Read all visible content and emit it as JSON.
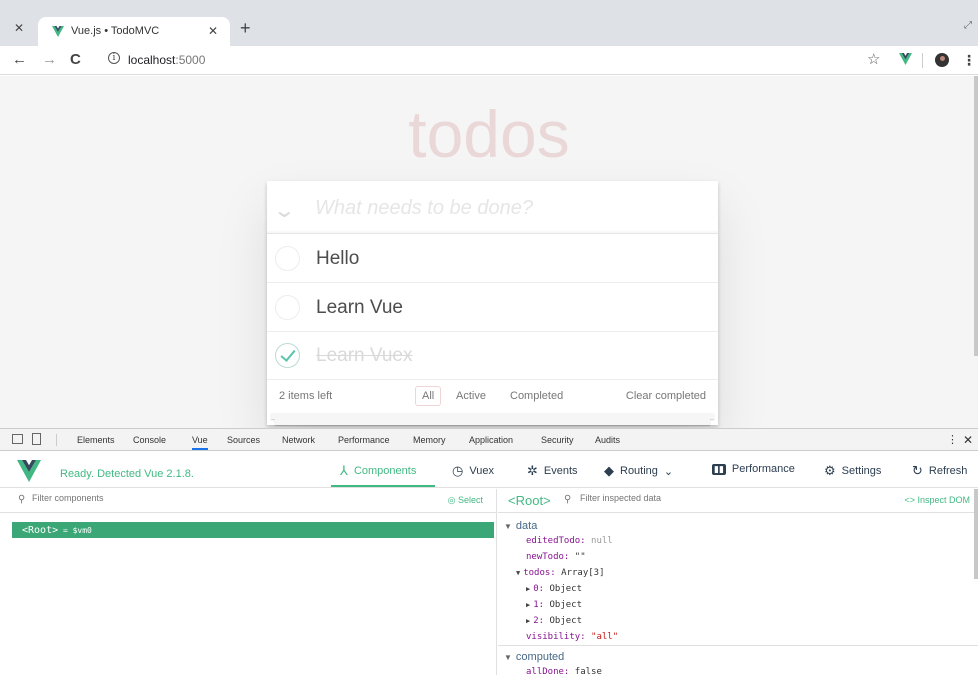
{
  "browser": {
    "tab_title": "Vue.js • TodoMVC",
    "url_host": "localhost",
    "url_port": ":5000"
  },
  "app": {
    "title": "todos",
    "new_todo_placeholder": "What needs to be done?",
    "todos": [
      {
        "label": "Hello",
        "completed": false
      },
      {
        "label": "Learn Vue",
        "completed": false
      },
      {
        "label": "Learn Vuex",
        "completed": true
      }
    ],
    "items_left": "2 items left",
    "filters": [
      "All",
      "Active",
      "Completed"
    ],
    "selected_filter": "All",
    "clear_completed": "Clear completed"
  },
  "devtools": {
    "tabs": [
      "Elements",
      "Console",
      "Vue",
      "Sources",
      "Network",
      "Performance",
      "Memory",
      "Application",
      "Security",
      "Audits"
    ],
    "active_tab": "Vue",
    "vue": {
      "status": "Ready. Detected Vue 2.1.8.",
      "toolbar": {
        "components": "Components",
        "vuex": "Vuex",
        "events": "Events",
        "routing": "Routing",
        "performance": "Performance",
        "settings": "Settings",
        "refresh": "Refresh"
      },
      "filter_components_placeholder": "Filter components",
      "select_label": "Select",
      "root_component": "<Root>",
      "root_ref": "= $vm0",
      "inspected_tag": "<Root>",
      "filter_inspected_placeholder": "Filter inspected data",
      "inspect_dom": "<> Inspect DOM",
      "data_section": "data",
      "data": {
        "editedTodo_key": "editedTodo:",
        "editedTodo_val": "null",
        "newTodo_key": "newTodo:",
        "newTodo_val": "\"\"",
        "todos_key": "todos:",
        "todos_val": "Array[3]",
        "item0_key": "0:",
        "item0_val": "Object",
        "item1_key": "1:",
        "item1_val": "Object",
        "item2_key": "2:",
        "item2_val": "Object",
        "visibility_key": "visibility:",
        "visibility_val": "\"all\""
      },
      "computed_section": "computed",
      "computed": {
        "allDone_key": "allDone:",
        "allDone_val": "false"
      }
    }
  },
  "colors": {
    "vue_green": "#42b983",
    "root_row": "#3ba776",
    "todos_title": "#af2f2f"
  }
}
